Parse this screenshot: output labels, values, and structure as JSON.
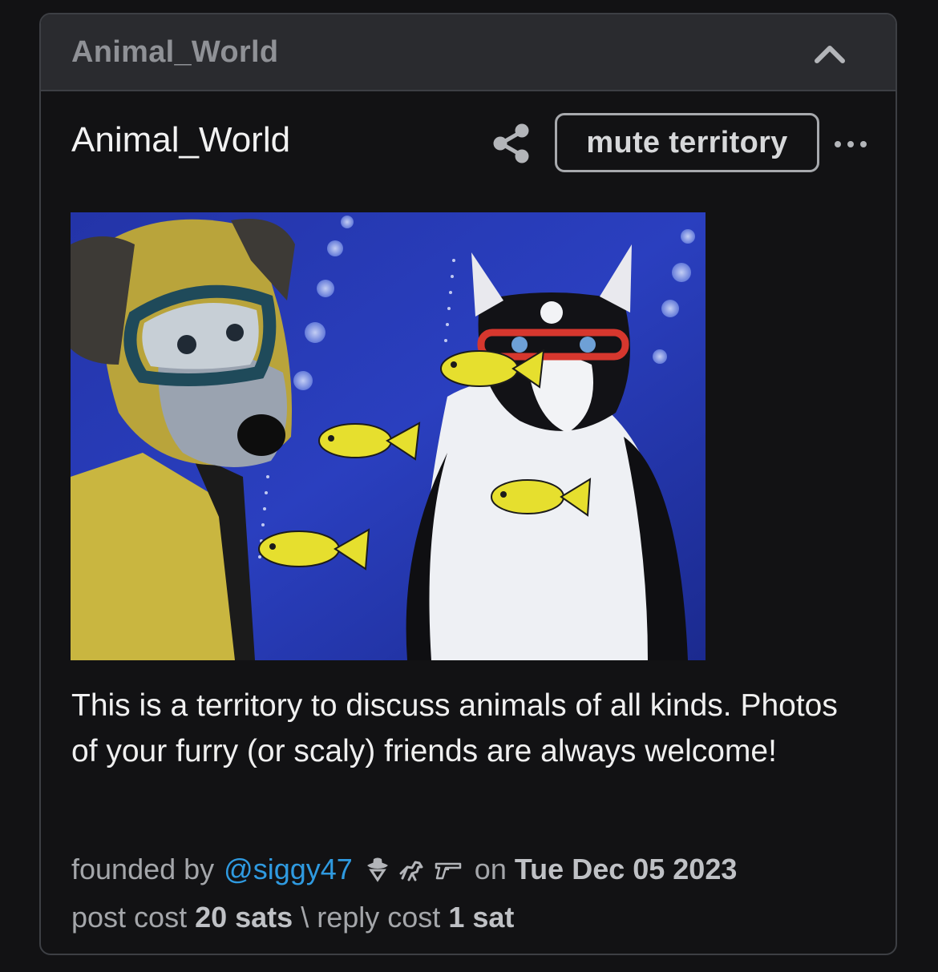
{
  "header": {
    "title": "Animal_World",
    "collapse_icon": "chevron-up-icon"
  },
  "territory": {
    "name": "Animal_World",
    "share_icon": "share-icon",
    "mute_label": "mute territory",
    "more_icon": "more-horizontal-icon",
    "image_subject": "painting of a dog and a cat wearing diving masks underwater with yellow fish",
    "description": "This is a territory to discuss animals of all kinds. Photos of your furry (or scaly) friends are always welcome!"
  },
  "meta": {
    "founded_prefix": "founded by",
    "founder": "@siggy47",
    "badges": [
      "cowboy-hat-icon",
      "horse-icon",
      "gun-icon"
    ],
    "on_label": "on",
    "date": "Tue Dec 05 2023",
    "post_cost_label": "post cost",
    "post_cost": "20 sats",
    "separator": "\\",
    "reply_cost_label": "reply cost",
    "reply_cost": "1 sat"
  },
  "colors": {
    "background": "#121214",
    "header_bg": "#2a2b2f",
    "link": "#2f9ae0",
    "border": "#3d3f44"
  }
}
